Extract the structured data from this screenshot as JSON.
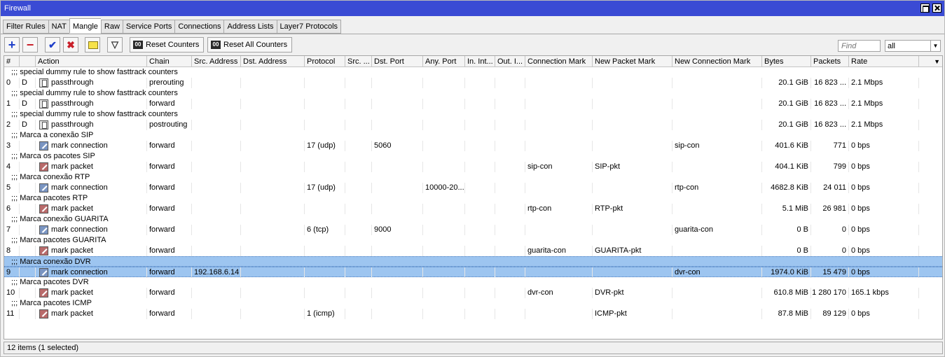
{
  "window": {
    "title": "Firewall"
  },
  "tabs": [
    "Filter Rules",
    "NAT",
    "Mangle",
    "Raw",
    "Service Ports",
    "Connections",
    "Address Lists",
    "Layer7 Protocols"
  ],
  "active_tab": "Mangle",
  "toolbar": {
    "reset_counters": "Reset Counters",
    "reset_all_counters": "Reset All Counters",
    "badge": "00",
    "find_placeholder": "Find",
    "filter_value": "all"
  },
  "columns": [
    "#",
    "",
    "Action",
    "Chain",
    "Src. Address",
    "Dst. Address",
    "Protocol",
    "Src. ...",
    "Dst. Port",
    "Any. Port",
    "In. Int...",
    "Out. I...",
    "Connection Mark",
    "New Packet Mark",
    "New Connection Mark",
    "Bytes",
    "Packets",
    "Rate"
  ],
  "rows": [
    {
      "comment": ";;; special dummy rule to show fasttrack counters"
    },
    {
      "num": "0",
      "flag": "D",
      "icon": "passthrough",
      "action": "passthrough",
      "chain": "prerouting",
      "src": "",
      "dst": "",
      "proto": "",
      "srcport": "",
      "dstport": "",
      "anyport": "",
      "inint": "",
      "outint": "",
      "connmark": "",
      "newpkt": "",
      "newconn": "",
      "bytes": "20.1 GiB",
      "packets": "16 823 ...",
      "rate": "2.1 Mbps"
    },
    {
      "comment": ";;; special dummy rule to show fasttrack counters"
    },
    {
      "num": "1",
      "flag": "D",
      "icon": "passthrough",
      "action": "passthrough",
      "chain": "forward",
      "src": "",
      "dst": "",
      "proto": "",
      "srcport": "",
      "dstport": "",
      "anyport": "",
      "inint": "",
      "outint": "",
      "connmark": "",
      "newpkt": "",
      "newconn": "",
      "bytes": "20.1 GiB",
      "packets": "16 823 ...",
      "rate": "2.1 Mbps"
    },
    {
      "comment": ";;; special dummy rule to show fasttrack counters"
    },
    {
      "num": "2",
      "flag": "D",
      "icon": "passthrough",
      "action": "passthrough",
      "chain": "postrouting",
      "src": "",
      "dst": "",
      "proto": "",
      "srcport": "",
      "dstport": "",
      "anyport": "",
      "inint": "",
      "outint": "",
      "connmark": "",
      "newpkt": "",
      "newconn": "",
      "bytes": "20.1 GiB",
      "packets": "16 823 ...",
      "rate": "2.1 Mbps"
    },
    {
      "comment": ";;; Marca a conexão SIP"
    },
    {
      "num": "3",
      "flag": "",
      "icon": "markconn",
      "action": "mark connection",
      "chain": "forward",
      "src": "",
      "dst": "",
      "proto": "17 (udp)",
      "srcport": "",
      "dstport": "5060",
      "anyport": "",
      "inint": "",
      "outint": "",
      "connmark": "",
      "newpkt": "",
      "newconn": "sip-con",
      "bytes": "401.6 KiB",
      "packets": "771",
      "rate": "0 bps"
    },
    {
      "comment": ";;; Marca os pacotes SIP"
    },
    {
      "num": "4",
      "flag": "",
      "icon": "markpkt",
      "action": "mark packet",
      "chain": "forward",
      "src": "",
      "dst": "",
      "proto": "",
      "srcport": "",
      "dstport": "",
      "anyport": "",
      "inint": "",
      "outint": "",
      "connmark": "sip-con",
      "newpkt": "SIP-pkt",
      "newconn": "",
      "bytes": "404.1 KiB",
      "packets": "799",
      "rate": "0 bps"
    },
    {
      "comment": ";;; Marca conexão RTP"
    },
    {
      "num": "5",
      "flag": "",
      "icon": "markconn",
      "action": "mark connection",
      "chain": "forward",
      "src": "",
      "dst": "",
      "proto": "17 (udp)",
      "srcport": "",
      "dstport": "",
      "anyport": "10000-20...",
      "inint": "",
      "outint": "",
      "connmark": "",
      "newpkt": "",
      "newconn": "rtp-con",
      "bytes": "4682.8 KiB",
      "packets": "24 011",
      "rate": "0 bps"
    },
    {
      "comment": ";;; Marca pacotes RTP"
    },
    {
      "num": "6",
      "flag": "",
      "icon": "markpkt",
      "action": "mark packet",
      "chain": "forward",
      "src": "",
      "dst": "",
      "proto": "",
      "srcport": "",
      "dstport": "",
      "anyport": "",
      "inint": "",
      "outint": "",
      "connmark": "rtp-con",
      "newpkt": "RTP-pkt",
      "newconn": "",
      "bytes": "5.1 MiB",
      "packets": "26 981",
      "rate": "0 bps"
    },
    {
      "comment": ";;; Marca conexão GUARITA"
    },
    {
      "num": "7",
      "flag": "",
      "icon": "markconn",
      "action": "mark connection",
      "chain": "forward",
      "src": "",
      "dst": "",
      "proto": "6 (tcp)",
      "srcport": "",
      "dstport": "9000",
      "anyport": "",
      "inint": "",
      "outint": "",
      "connmark": "",
      "newpkt": "",
      "newconn": "guarita-con",
      "bytes": "0 B",
      "packets": "0",
      "rate": "0 bps"
    },
    {
      "comment": ";;; Marca pacotes GUARITA"
    },
    {
      "num": "8",
      "flag": "",
      "icon": "markpkt",
      "action": "mark packet",
      "chain": "forward",
      "src": "",
      "dst": "",
      "proto": "",
      "srcport": "",
      "dstport": "",
      "anyport": "",
      "inint": "",
      "outint": "",
      "connmark": "guarita-con",
      "newpkt": "GUARITA-pkt",
      "newconn": "",
      "bytes": "0 B",
      "packets": "0",
      "rate": "0 bps"
    },
    {
      "comment": ";;; Marca conexão DVR",
      "selected": true
    },
    {
      "num": "9",
      "flag": "",
      "icon": "markconn",
      "action": "mark connection",
      "chain": "forward",
      "src": "192.168.6.14",
      "dst": "",
      "proto": "",
      "srcport": "",
      "dstport": "",
      "anyport": "",
      "inint": "",
      "outint": "",
      "connmark": "",
      "newpkt": "",
      "newconn": "dvr-con",
      "bytes": "1974.0 KiB",
      "packets": "15 479",
      "rate": "0 bps",
      "selected": true
    },
    {
      "comment": ";;; Marca pacotes DVR"
    },
    {
      "num": "10",
      "flag": "",
      "icon": "markpkt",
      "action": "mark packet",
      "chain": "forward",
      "src": "",
      "dst": "",
      "proto": "",
      "srcport": "",
      "dstport": "",
      "anyport": "",
      "inint": "",
      "outint": "",
      "connmark": "dvr-con",
      "newpkt": "DVR-pkt",
      "newconn": "",
      "bytes": "610.8 MiB",
      "packets": "1 280 170",
      "rate": "165.1 kbps"
    },
    {
      "comment": ";;; Marca pacotes ICMP"
    },
    {
      "num": "11",
      "flag": "",
      "icon": "markpkt",
      "action": "mark packet",
      "chain": "forward",
      "src": "",
      "dst": "",
      "proto": "1 (icmp)",
      "srcport": "",
      "dstport": "",
      "anyport": "",
      "inint": "",
      "outint": "",
      "connmark": "",
      "newpkt": "ICMP-pkt",
      "newconn": "",
      "bytes": "87.8 MiB",
      "packets": "89 129",
      "rate": "0 bps"
    }
  ],
  "status": "12 items (1 selected)"
}
